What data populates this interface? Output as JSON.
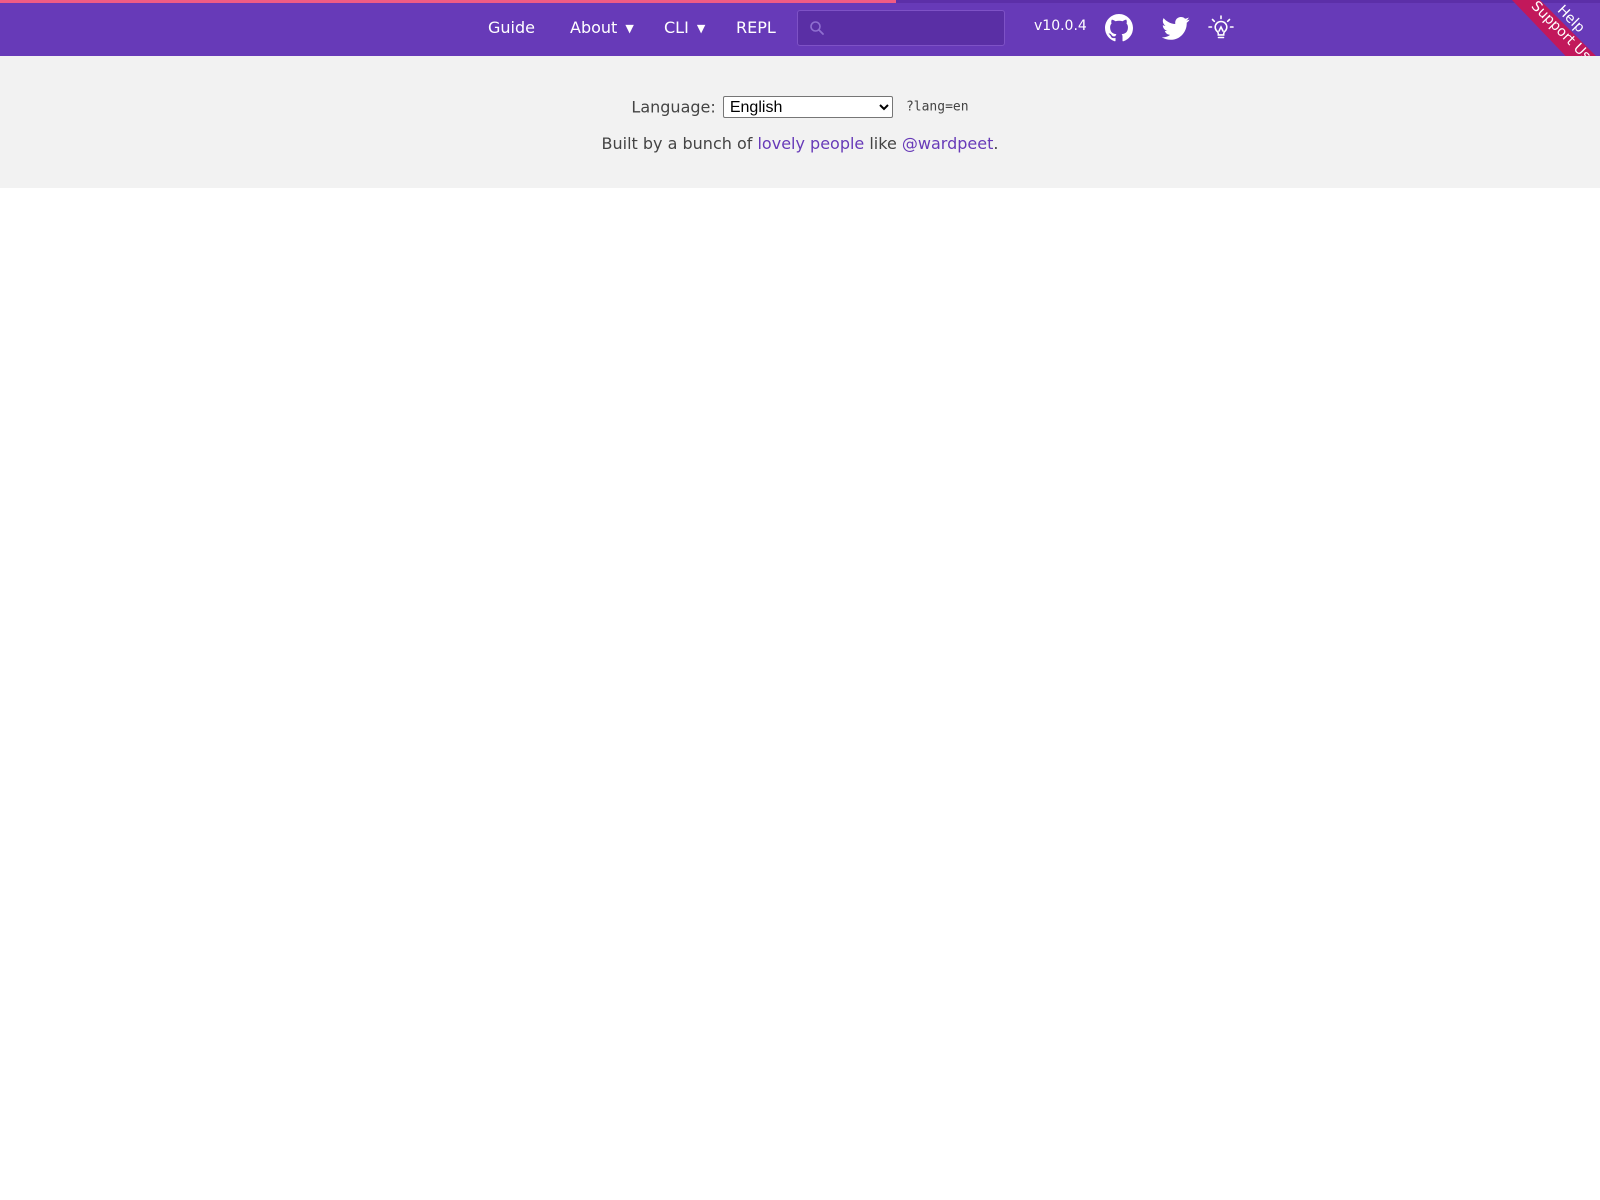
{
  "colors": {
    "header_bg": "#673ab8",
    "progress_fill": "#f05b84",
    "ribbon": "#c2185b",
    "band_bg": "#f2f2f2",
    "link": "#673ab8"
  },
  "loading_progress": 0.56,
  "nav": {
    "items": [
      {
        "label": "Guide"
      },
      {
        "label": "About",
        "caret": "▼"
      },
      {
        "label": "CLI",
        "caret": "▼"
      },
      {
        "label": "REPL"
      }
    ],
    "search": {
      "icon": "search-icon",
      "placeholder": "",
      "value": ""
    },
    "version": "v10.0.4",
    "icons": [
      "github-icon",
      "twitter-icon",
      "lightbulb-icon"
    ]
  },
  "ribbon": {
    "line1": "Help",
    "line2": "Support Us"
  },
  "footer": {
    "language_label": "Language:",
    "language_selected": "English",
    "lang_param": "?lang=en",
    "credits": {
      "prefix": "Built by a bunch of",
      "link1": "lovely people",
      "middle": "like",
      "link2": "@wardpeet",
      "suffix": "."
    }
  }
}
